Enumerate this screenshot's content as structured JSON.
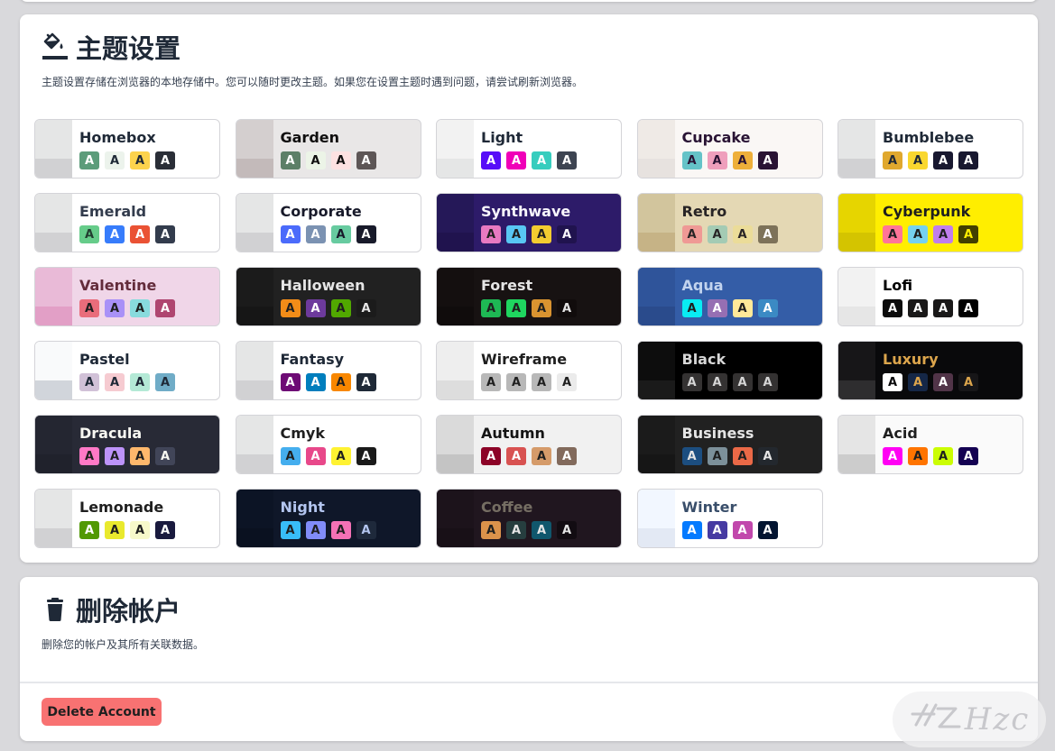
{
  "theme_section": {
    "title": "主题设置",
    "icon": "paint-bucket-icon",
    "description": "主题设置存储在浏览器的本地存储中。您可以随时更改主题。如果您在设置主题时遇到问题，请尝试刷新浏览器。"
  },
  "swatch_letter": "A",
  "themes": [
    {
      "name": "Homebox",
      "bg": "#ffffff",
      "fg": "#1f2937",
      "s1": "#e5e6e6",
      "s2": "#d1d1d3",
      "sw": [
        [
          "#5c9c7a",
          "#ffffff"
        ],
        [
          "#ecf3ec",
          "#1f2937"
        ],
        [
          "#fcd34d",
          "#1f2937"
        ],
        [
          "#2a2e37",
          "#ffffff"
        ]
      ]
    },
    {
      "name": "Garden",
      "bg": "#e9e7e7",
      "fg": "#100f0f",
      "s1": "#d4cfcf",
      "s2": "#c3baba",
      "sw": [
        [
          "#5c7f67",
          "#ffffff"
        ],
        [
          "#ecf4e7",
          "#100f0f"
        ],
        [
          "#fde2e2",
          "#100f0f"
        ],
        [
          "#5d5656",
          "#ffffff"
        ]
      ]
    },
    {
      "name": "Light",
      "bg": "#ffffff",
      "fg": "#1f2937",
      "s1": "#f2f2f2",
      "s2": "#e5e6e6",
      "sw": [
        [
          "#570df8",
          "#ffffff"
        ],
        [
          "#f000b8",
          "#ffffff"
        ],
        [
          "#37cdbe",
          "#ffffff"
        ],
        [
          "#3d4451",
          "#ffffff"
        ]
      ]
    },
    {
      "name": "Cupcake",
      "bg": "#faf7f5",
      "fg": "#291334",
      "s1": "#efeae6",
      "s2": "#e7e2df",
      "sw": [
        [
          "#65c3c8",
          "#291334"
        ],
        [
          "#ef9fbc",
          "#291334"
        ],
        [
          "#eeaf3a",
          "#291334"
        ],
        [
          "#291334",
          "#ffffff"
        ]
      ]
    },
    {
      "name": "Bumblebee",
      "bg": "#ffffff",
      "fg": "#1f2937",
      "s1": "#e5e6e6",
      "s2": "#d1d1d3",
      "sw": [
        [
          "#e0a82e",
          "#1f2937"
        ],
        [
          "#f9d72f",
          "#1f2937"
        ],
        [
          "#181830",
          "#ffffff"
        ],
        [
          "#181830",
          "#ffffff"
        ]
      ]
    },
    {
      "name": "Emerald",
      "bg": "#ffffff",
      "fg": "#333c4d",
      "s1": "#e5e6e6",
      "s2": "#d1d1d3",
      "sw": [
        [
          "#66cc8a",
          "#223d30"
        ],
        [
          "#377cfb",
          "#ffffff"
        ],
        [
          "#ea5234",
          "#ffffff"
        ],
        [
          "#333c4d",
          "#ffffff"
        ]
      ]
    },
    {
      "name": "Corporate",
      "bg": "#ffffff",
      "fg": "#181a2a",
      "s1": "#e5e6e6",
      "s2": "#d1d1d3",
      "sw": [
        [
          "#4b6bfb",
          "#ffffff"
        ],
        [
          "#7b92b2",
          "#ffffff"
        ],
        [
          "#67cba0",
          "#181a2a"
        ],
        [
          "#181a2a",
          "#ffffff"
        ]
      ]
    },
    {
      "name": "Synthwave",
      "bg": "#2d1b69",
      "fg": "#f9f7fd",
      "s1": "#251858",
      "s2": "#20134e",
      "sw": [
        [
          "#e779c1",
          "#1f1f1f"
        ],
        [
          "#58c7f3",
          "#1f1f1f"
        ],
        [
          "#f3cc30",
          "#1f1f1f"
        ],
        [
          "#20134e",
          "#f9f7fd"
        ]
      ]
    },
    {
      "name": "Retro",
      "bg": "#e4d8b4",
      "fg": "#282425",
      "s1": "#d2c59d",
      "s2": "#c6b386",
      "sw": [
        [
          "#ef9995",
          "#282425"
        ],
        [
          "#a4cbb4",
          "#282425"
        ],
        [
          "#ebdc99",
          "#282425"
        ],
        [
          "#7d7259",
          "#ffffff"
        ]
      ]
    },
    {
      "name": "Cyberpunk",
      "bg": "#ffee00",
      "fg": "#1f1f1f",
      "s1": "#e6d500",
      "s2": "#d4c400",
      "sw": [
        [
          "#ff7598",
          "#1f1f1f"
        ],
        [
          "#75d1f0",
          "#1f1f1f"
        ],
        [
          "#c07eec",
          "#1f1f1f"
        ],
        [
          "#423f00",
          "#ffee00"
        ]
      ]
    },
    {
      "name": "Valentine",
      "bg": "#f0d6e8",
      "fg": "#632c3b",
      "s1": "#e9bad7",
      "s2": "#e29fc6",
      "sw": [
        [
          "#e96d7b",
          "#1f1f1f"
        ],
        [
          "#a991f7",
          "#1f1f1f"
        ],
        [
          "#88dbdd",
          "#1f1f1f"
        ],
        [
          "#af4670",
          "#ffffff"
        ]
      ]
    },
    {
      "name": "Halloween",
      "bg": "#212121",
      "fg": "#e5e5e5",
      "s1": "#1b1b1b",
      "s2": "#161616",
      "sw": [
        [
          "#f28c18",
          "#1f1f1f"
        ],
        [
          "#6d3a9c",
          "#ffffff"
        ],
        [
          "#51a800",
          "#1f1f1f"
        ],
        [
          "#1b1b1b",
          "#e5e5e5"
        ]
      ]
    },
    {
      "name": "Forest",
      "bg": "#171212",
      "fg": "#e5e5e5",
      "s1": "#140f0f",
      "s2": "#100c0c",
      "sw": [
        [
          "#1eb854",
          "#1f1f1f"
        ],
        [
          "#1fd65f",
          "#1f1f1f"
        ],
        [
          "#d99330",
          "#1f1f1f"
        ],
        [
          "#110c0c",
          "#e5e5e5"
        ]
      ]
    },
    {
      "name": "Aqua",
      "bg": "#345da7",
      "fg": "#c2d3ee",
      "s1": "#2f549a",
      "s2": "#2a4b8c",
      "sw": [
        [
          "#09ecf3",
          "#1f1f1f"
        ],
        [
          "#966fb3",
          "#ffffff"
        ],
        [
          "#ffe999",
          "#1f1f1f"
        ],
        [
          "#3b8ac4",
          "#ffffff"
        ]
      ]
    },
    {
      "name": "Lofi",
      "bg": "#ffffff",
      "fg": "#000000",
      "s1": "#f2f2f2",
      "s2": "#e6e6e6",
      "sw": [
        [
          "#0d0d0d",
          "#ffffff"
        ],
        [
          "#1a1919",
          "#ffffff"
        ],
        [
          "#1a1919",
          "#ffffff"
        ],
        [
          "#000000",
          "#ffffff"
        ]
      ]
    },
    {
      "name": "Pastel",
      "bg": "#ffffff",
      "fg": "#1f2937",
      "s1": "#f9fafb",
      "s2": "#d1d5db",
      "sw": [
        [
          "#d1c1d7",
          "#1f2937"
        ],
        [
          "#f6cbd1",
          "#1f2937"
        ],
        [
          "#b4e9d6",
          "#1f2937"
        ],
        [
          "#70acc7",
          "#1f2937"
        ]
      ]
    },
    {
      "name": "Fantasy",
      "bg": "#ffffff",
      "fg": "#1f2937",
      "s1": "#e5e6e6",
      "s2": "#d1d1d3",
      "sw": [
        [
          "#6e0b75",
          "#ffffff"
        ],
        [
          "#007ebd",
          "#ffffff"
        ],
        [
          "#f88700",
          "#1f1f1f"
        ],
        [
          "#1f2937",
          "#ffffff"
        ]
      ]
    },
    {
      "name": "Wireframe",
      "bg": "#ffffff",
      "fg": "#1f1f1f",
      "s1": "#eeeeee",
      "s2": "#dddddd",
      "sw": [
        [
          "#b8b8b8",
          "#1f1f1f"
        ],
        [
          "#b8b8b8",
          "#1f1f1f"
        ],
        [
          "#b8b8b8",
          "#1f1f1f"
        ],
        [
          "#ebebeb",
          "#1f1f1f"
        ]
      ]
    },
    {
      "name": "Black",
      "bg": "#000000",
      "fg": "#d6d6d6",
      "s1": "#0d0d0d",
      "s2": "#1a1a1a",
      "sw": [
        [
          "#343232",
          "#d6d6d6"
        ],
        [
          "#343232",
          "#d6d6d6"
        ],
        [
          "#343232",
          "#d6d6d6"
        ],
        [
          "#343232",
          "#d6d6d6"
        ]
      ]
    },
    {
      "name": "Luxury",
      "bg": "#09090b",
      "fg": "#dca54c",
      "s1": "#171618",
      "s2": "#2e2d2f",
      "sw": [
        [
          "#ffffff",
          "#09090b"
        ],
        [
          "#152747",
          "#dca54c"
        ],
        [
          "#513448",
          "#ffffff"
        ],
        [
          "#171618",
          "#dca54c"
        ]
      ]
    },
    {
      "name": "Dracula",
      "bg": "#282a36",
      "fg": "#f8f8f2",
      "s1": "#242631",
      "s2": "#20222c",
      "sw": [
        [
          "#ff79c6",
          "#1f1f1f"
        ],
        [
          "#bd93f9",
          "#1f1f1f"
        ],
        [
          "#ffb86c",
          "#1f1f1f"
        ],
        [
          "#414558",
          "#f8f8f2"
        ]
      ]
    },
    {
      "name": "Cmyk",
      "bg": "#ffffff",
      "fg": "#1f1f1f",
      "s1": "#e5e6e6",
      "s2": "#d1d1d3",
      "sw": [
        [
          "#45aeee",
          "#1f1f1f"
        ],
        [
          "#e8488a",
          "#ffffff"
        ],
        [
          "#fff232",
          "#1f1f1f"
        ],
        [
          "#1a1a1a",
          "#ffffff"
        ]
      ]
    },
    {
      "name": "Autumn",
      "bg": "#f1f1f1",
      "fg": "#141414",
      "s1": "#dadada",
      "s2": "#c4c4c4",
      "sw": [
        [
          "#8c0327",
          "#ffffff"
        ],
        [
          "#d85251",
          "#ffffff"
        ],
        [
          "#d59b6a",
          "#1f1f1f"
        ],
        [
          "#826a5c",
          "#ffffff"
        ]
      ]
    },
    {
      "name": "Business",
      "bg": "#212121",
      "fg": "#e5e5e5",
      "s1": "#1b1b1b",
      "s2": "#161616",
      "sw": [
        [
          "#1c4e80",
          "#e5e5e5"
        ],
        [
          "#7c909a",
          "#1f1f1f"
        ],
        [
          "#ea6947",
          "#1f1f1f"
        ],
        [
          "#23282e",
          "#e5e5e5"
        ]
      ]
    },
    {
      "name": "Acid",
      "bg": "#fafafa",
      "fg": "#1f1f1f",
      "s1": "#e5e5e5",
      "s2": "#cccccc",
      "sw": [
        [
          "#ff00f4",
          "#ffffff"
        ],
        [
          "#ff7400",
          "#1f1f1f"
        ],
        [
          "#cbfd03",
          "#1f1f1f"
        ],
        [
          "#140152",
          "#ffffff"
        ]
      ]
    },
    {
      "name": "Lemonade",
      "bg": "#ffffff",
      "fg": "#1f1f1f",
      "s1": "#e5e6e6",
      "s2": "#d1d1d3",
      "sw": [
        [
          "#519903",
          "#ffffff"
        ],
        [
          "#e9e92e",
          "#1f1f1f"
        ],
        [
          "#f7f9ca",
          "#1f1f1f"
        ],
        [
          "#191a3e",
          "#ffffff"
        ]
      ]
    },
    {
      "name": "Night",
      "bg": "#0f1729",
      "fg": "#b3c5ef",
      "s1": "#0c1425",
      "s2": "#0a1120",
      "sw": [
        [
          "#38bdf8",
          "#1f1f1f"
        ],
        [
          "#818cf8",
          "#1f1f1f"
        ],
        [
          "#f471b5",
          "#1f1f1f"
        ],
        [
          "#1e293b",
          "#b3c5ef"
        ]
      ]
    },
    {
      "name": "Coffee",
      "bg": "#20161f",
      "fg": "#756e63",
      "s1": "#1c131b",
      "s2": "#181017",
      "sw": [
        [
          "#db924b",
          "#1f1f1f"
        ],
        [
          "#263e3f",
          "#e5e5e5"
        ],
        [
          "#10576d",
          "#e5e5e5"
        ],
        [
          "#120c12",
          "#e5e5e5"
        ]
      ]
    },
    {
      "name": "Winter",
      "bg": "#ffffff",
      "fg": "#394e6a",
      "s1": "#f2f7ff",
      "s2": "#e3e9f4",
      "sw": [
        [
          "#047aff",
          "#ffffff"
        ],
        [
          "#463aa2",
          "#ffffff"
        ],
        [
          "#c148ac",
          "#ffffff"
        ],
        [
          "#021431",
          "#ffffff"
        ]
      ]
    }
  ],
  "danger_section": {
    "title": "删除帐户",
    "icon": "trash-icon",
    "description": "删除您的帐户及其所有关联数据。",
    "button_label": "Delete Account"
  },
  "watermark": {
    "text": "Hzc",
    "logo": "hz-logo-icon"
  },
  "colors": {
    "danger": "#f87272",
    "card_bg": "#ffffff",
    "page_bg": "#d9d9dc"
  }
}
